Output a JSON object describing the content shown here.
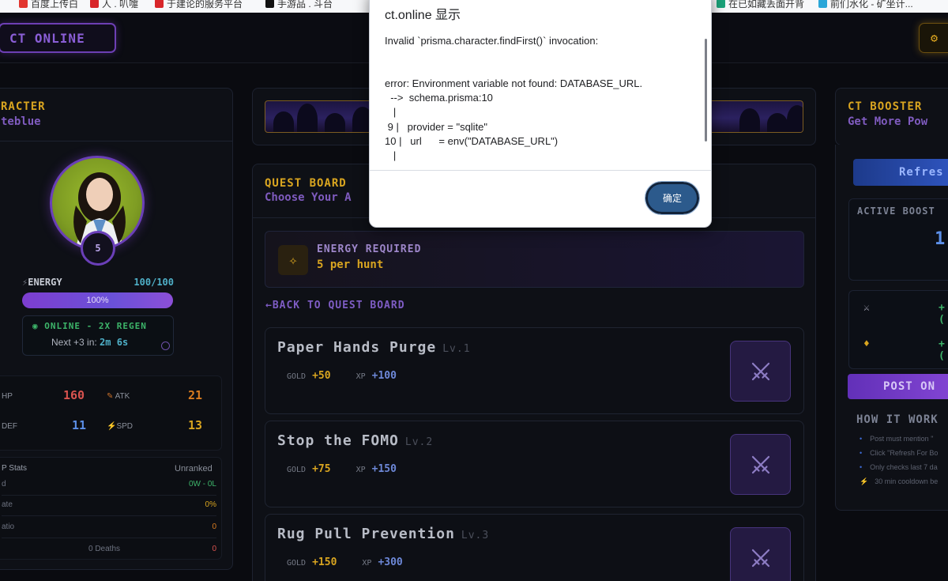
{
  "bookmarks": [
    {
      "label": "百度上传白",
      "color": "#e2362f"
    },
    {
      "label": "人 . 叭嚏",
      "color": "#d8262a"
    },
    {
      "label": "于建论的服务平台",
      "color": "#d8262a"
    },
    {
      "label": "手游品 . 斗台",
      "color": "#111111"
    },
    {
      "label": "在已如藏丢面开背",
      "color": "#1aa37a"
    },
    {
      "label": "前们水化 - 矿坐计...",
      "color": "#2aa6d8"
    }
  ],
  "header": {
    "logo": "CT ONLINE",
    "right_icon": "coins-icon"
  },
  "character": {
    "title": "RACTER",
    "name": "teblue",
    "level": "5",
    "energy_label": "ENERGY",
    "energy_value": "100/100",
    "energy_percent": 100,
    "energy_bar_text": "100%",
    "online_status": "ONLINE - 2X REGEN",
    "regen_prefix": "Next +3 in:",
    "regen_time": "2m 6s",
    "stats": {
      "hp_label": "HP",
      "hp": "160",
      "atk_label": "ATK",
      "atk": "21",
      "def_label": "DEF",
      "def": "11",
      "spd_label": "SPD",
      "spd": "13"
    },
    "pvp": {
      "title": "P Stats",
      "rank": "Unranked",
      "row1_label": "d",
      "row1_value": "0W - 0L",
      "row2_label": "ate",
      "row2_value": "0%",
      "row3_label": "atio",
      "row3_value": "0",
      "row4_label": "0 Deaths",
      "row4_value": "0"
    }
  },
  "quest_board": {
    "title": "QUEST BOARD",
    "subtitle": "Choose Your A",
    "energy_required_label": "ENERGY REQUIRED",
    "energy_required_value": "5 per hunt",
    "back_link": "BACK TO QUEST BOARD",
    "quests": [
      {
        "name": "Paper Hands Purge",
        "level": "Lv.1",
        "gold_label": "GOLD",
        "gold": "+50",
        "xp_label": "XP",
        "xp": "+100"
      },
      {
        "name": "Stop the FOMO",
        "level": "Lv.2",
        "gold_label": "GOLD",
        "gold": "+75",
        "xp_label": "XP",
        "xp": "+150"
      },
      {
        "name": "Rug Pull Prevention",
        "level": "Lv.3",
        "gold_label": "GOLD",
        "gold": "+150",
        "xp_label": "XP",
        "xp": "+300"
      }
    ]
  },
  "booster": {
    "title": "CT BOOSTER",
    "subtitle": "Get More Pow",
    "refresh": "Refres",
    "active_label": "ACTIVE BOOST",
    "active_value": "1",
    "reward1": "+(",
    "reward2": "+(",
    "post": "POST ON",
    "how_title": "HOW IT WORK",
    "how_items": [
      "Post must mention \"",
      "Click \"Refresh For Bo",
      "Only checks last 7 da",
      "30 min cooldown be"
    ]
  },
  "dialog": {
    "title": "ct.online 显示",
    "lines": [
      "Invalid `prisma.character.findFirst()` invocation:",
      "error: Environment variable not found: DATABASE_URL.",
      "  -->  schema.prisma:10",
      "   |",
      " 9 |   provider = \"sqlite\"",
      "10 |   url      = env(\"DATABASE_URL\")",
      "   |"
    ],
    "ok": "确定"
  }
}
